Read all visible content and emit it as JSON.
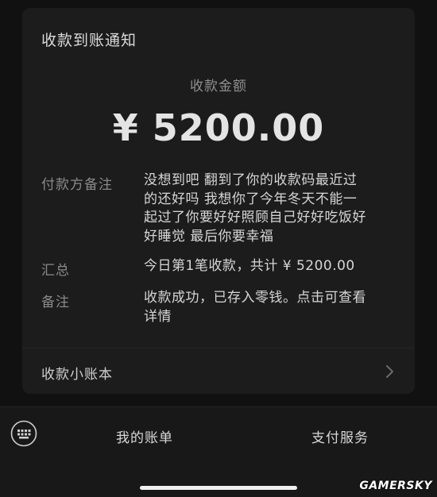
{
  "notification": {
    "title": "收款到账通知",
    "amount_label": "收款金额",
    "amount": "¥ 5200.00"
  },
  "details": [
    {
      "key": "付款方备注",
      "lines": [
        "没想到吧 翻到了你的收款码最近过",
        "的还好吗 我想你了今年冬天不能一",
        "起过了你要好好照顾自己好好吃饭好",
        "好睡觉 最后你要幸福"
      ]
    },
    {
      "key": "汇总",
      "lines": [
        "今日第1笔收款，共计 ¥ 5200.00"
      ]
    },
    {
      "key": "备注",
      "lines": [
        "收款成功，已存入零钱。点击可查看",
        "详情"
      ]
    }
  ],
  "ledger": {
    "label": "收款小账本",
    "icon": "chevron-right-icon"
  },
  "bottom_menu": {
    "keyboard_icon": "keyboard-icon",
    "items": [
      "我的账单",
      "支付服务"
    ]
  },
  "watermark": {
    "text": "GAMERSKY"
  },
  "colors": {
    "background": "#111111",
    "card": "#1c1c1c",
    "text_primary": "#e4e4e4",
    "text_secondary": "#8a8a8a"
  }
}
